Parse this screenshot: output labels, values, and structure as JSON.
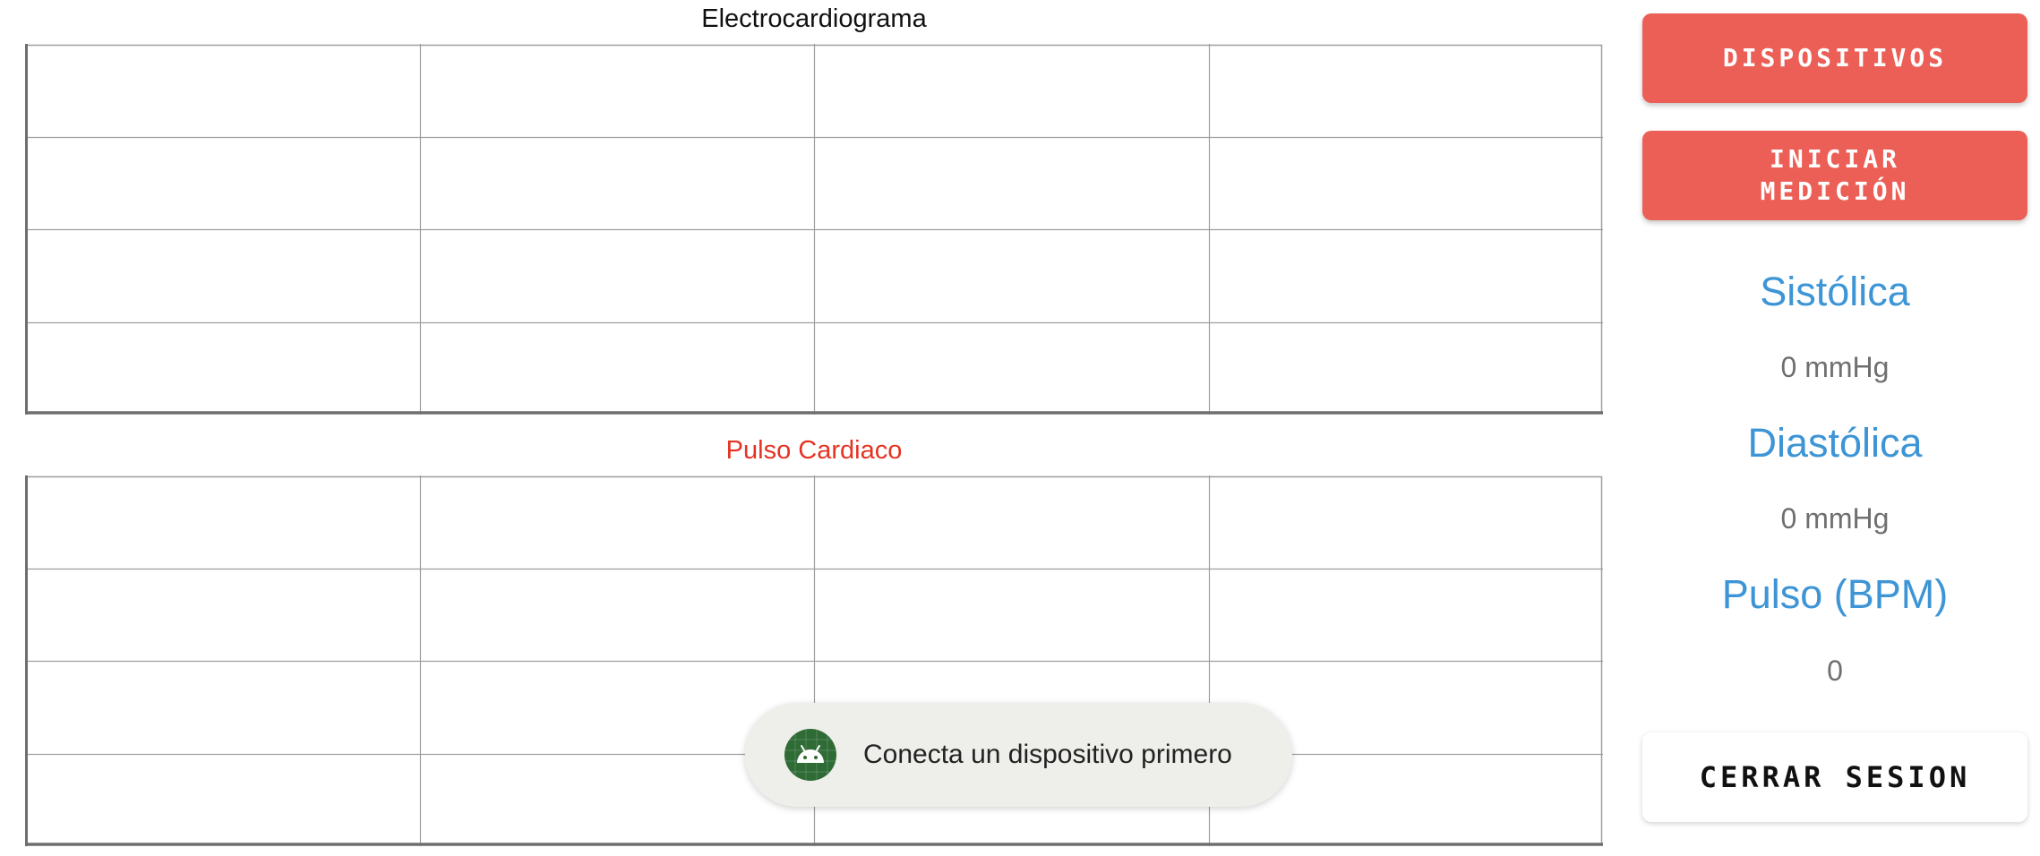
{
  "charts": [
    {
      "title": "Electrocardiograma",
      "title_color": "#111111",
      "grid_columns": 4,
      "grid_rows": 4,
      "values": []
    },
    {
      "title": "Pulso Cardiaco",
      "title_color": "#e53323",
      "grid_columns": 4,
      "grid_rows": 4,
      "values": []
    }
  ],
  "sidebar": {
    "devices_button": "DISPOSITIVOS",
    "start_button": "INICIAR\nMEDICIÓN",
    "systolic_label": "Sistólica",
    "systolic_value": "0 mmHg",
    "diastolic_label": "Diastólica",
    "diastolic_value": "0 mmHg",
    "pulse_label": "Pulso (BPM)",
    "pulse_value": "0",
    "logout_button": "CERRAR SESION"
  },
  "toast": {
    "icon": "android-icon",
    "message": "Conecta un dispositivo primero"
  },
  "colors": {
    "accent_button": "#ec5f57",
    "metric_label": "#3e95d6",
    "grid_line": "#9e9e9e",
    "axis_line": "#6e6e6e",
    "toast_icon_bg": "#2e6b35"
  }
}
